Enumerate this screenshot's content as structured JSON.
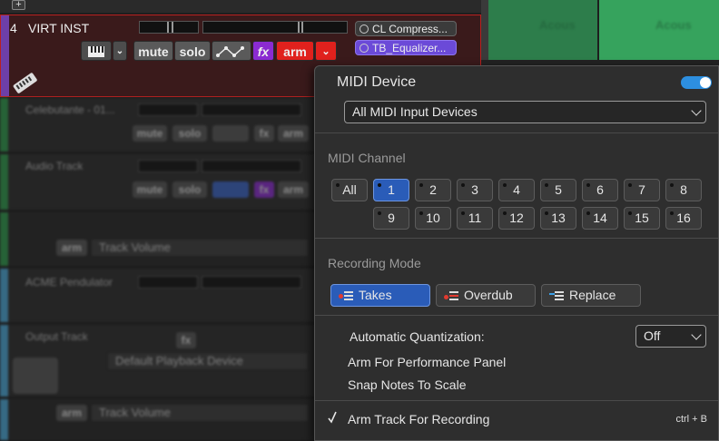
{
  "daw": {
    "add_button": "+",
    "virt_track": {
      "number": "4",
      "name": "VIRT INST",
      "mute": "mute",
      "solo": "solo",
      "fx": "fx",
      "arm": "arm",
      "plugins": [
        "CL Compress...",
        "TB_Equalizer..."
      ]
    },
    "bg_tracks": [
      {
        "name": "Celebutante - 01...",
        "mute": "mute",
        "solo": "solo",
        "fx": "fx",
        "arm": "arm"
      },
      {
        "name": "Audio Track",
        "mute": "mute",
        "solo": "solo",
        "fx": "fx",
        "arm": "arm"
      },
      {
        "automation": "Track Volume",
        "arm": "arm"
      },
      {
        "name": "ACME Pendulator"
      },
      {
        "name": "Output Track",
        "fx": "fx",
        "device": "Default Playback Device"
      },
      {
        "automation": "Track Volume",
        "arm": "arm"
      }
    ],
    "clips": [
      "Acous",
      "Acous"
    ],
    "colors": {
      "virt_strip": "#6d3fa8",
      "virt_border": "#b9201f",
      "arm_red": "#e0211d",
      "fx_purple": "#8b2bd1",
      "clip_green": "#36a35d"
    }
  },
  "popup": {
    "midi_device_title": "MIDI Device",
    "device_enabled": true,
    "device_select": "All MIDI Input Devices",
    "midi_channel_title": "MIDI Channel",
    "channel_all": "All",
    "channels": [
      "1",
      "2",
      "3",
      "4",
      "5",
      "6",
      "7",
      "8",
      "9",
      "10",
      "11",
      "12",
      "13",
      "14",
      "15",
      "16"
    ],
    "selected_channel": "1",
    "recording_mode_title": "Recording Mode",
    "modes": [
      "Takes",
      "Overdub",
      "Replace"
    ],
    "selected_mode": "Takes",
    "auto_quant_label": "Automatic Quantization:",
    "auto_quant_value": "Off",
    "arm_performance": "Arm For Performance Panel",
    "snap_notes": "Snap Notes To Scale",
    "arm_track": "Arm Track For Recording",
    "arm_track_checked": true,
    "arm_shortcut": "ctrl + B",
    "colors": {
      "accent": "#2a5cb8",
      "toggle": "#2d8fe0"
    }
  }
}
